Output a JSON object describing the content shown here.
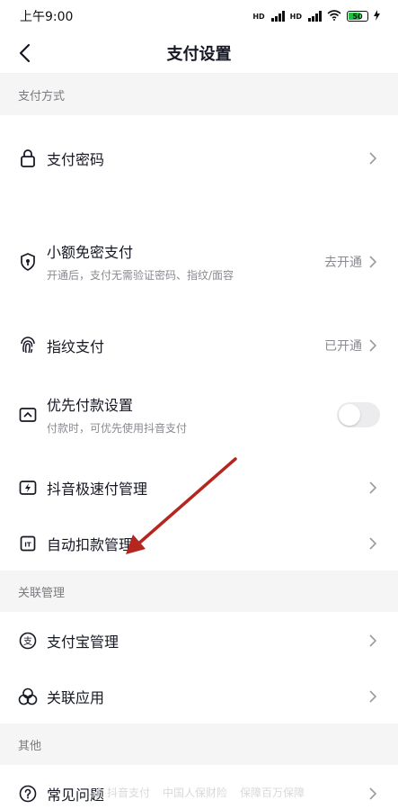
{
  "status_bar": {
    "time": "上午9:00",
    "battery": "50"
  },
  "nav": {
    "title": "支付设置"
  },
  "sections": {
    "payment_methods": "支付方式",
    "linked": "关联管理",
    "other": "其他"
  },
  "rows": {
    "pay_password": {
      "label": "支付密码"
    },
    "small_free": {
      "label": "小额免密支付",
      "sub": "开通后，支付无需验证密码、指纹/面容",
      "status": "去开通"
    },
    "fingerprint": {
      "label": "指纹支付",
      "status": "已开通"
    },
    "priority": {
      "label": "优先付款设置",
      "sub": "付款时，可优先使用抖音支付",
      "toggle_on": false
    },
    "speed_pay": {
      "label": "抖音极速付管理"
    },
    "auto_debit": {
      "label": "自动扣款管理"
    },
    "alipay": {
      "label": "支付宝管理"
    },
    "linked_apps": {
      "label": "关联应用"
    },
    "faq": {
      "label": "常见问题"
    }
  },
  "footer": {
    "brand": "抖音支付",
    "insurer": "中国人保财险",
    "guarantee": "保障百万保障"
  },
  "colors": {
    "annotation_arrow": "#b5261e",
    "section_bg": "#f5f5f5",
    "toggle_off": "#ececee"
  }
}
